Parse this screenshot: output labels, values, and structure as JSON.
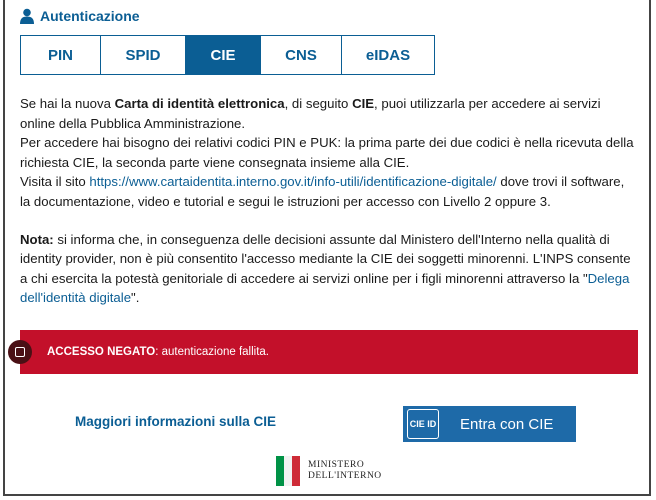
{
  "header": {
    "title": "Autenticazione",
    "icon": "user-icon"
  },
  "tabs": [
    {
      "label": "PIN",
      "active": false
    },
    {
      "label": "SPID",
      "active": false
    },
    {
      "label": "CIE",
      "active": true
    },
    {
      "label": "CNS",
      "active": false
    },
    {
      "label": "eIDAS",
      "active": false
    }
  ],
  "content": {
    "p1_prefix": "Se hai la nuova ",
    "p1_bold": "Carta di identità elettronica",
    "p1_mid": ", di seguito ",
    "p1_bold2": "CIE",
    "p1_suffix": ", puoi utilizzarla per accedere ai servizi online della Pubblica Amministrazione.",
    "p2": "Per accedere hai bisogno dei relativi codici PIN e PUK: la prima parte dei due codici è nella ricevuta della richiesta CIE, la seconda parte viene consegnata insieme alla CIE.",
    "p3_prefix": "Visita il sito ",
    "p3_link": "https://www.cartaidentita.interno.gov.it/info-utili/identificazione-digitale/",
    "p3_suffix": " dove trovi il software, la documentazione, video e tutorial e segui le istruzioni per accesso con Livello 2 oppure 3.",
    "note_label": "Nota:",
    "note_text": " si informa che, in conseguenza delle decisioni assunte dal Ministero dell'Interno nella qualità di identity provider, non è più consentito l'accesso mediante la CIE dei soggetti minorenni. L'INPS consente a chi esercita la potestà genitoriale di accedere ai servizi online per i figli minorenni attraverso la \"",
    "note_link": "Delega dell'identità digitale",
    "note_end": "\"."
  },
  "alert": {
    "title": "ACCESSO NEGATO",
    "message": ": autenticazione fallita.",
    "color": "#c3102a"
  },
  "footer": {
    "more_link": "Maggiori informazioni sulla CIE",
    "cie_logo": "CIE ID",
    "cie_button": "Entra con CIE",
    "ministry_line1": "MINISTERO",
    "ministry_line2": "DELL'INTERNO"
  },
  "colors": {
    "brand": "#0b5e94",
    "button": "#1e6aa8",
    "alert": "#c3102a"
  }
}
